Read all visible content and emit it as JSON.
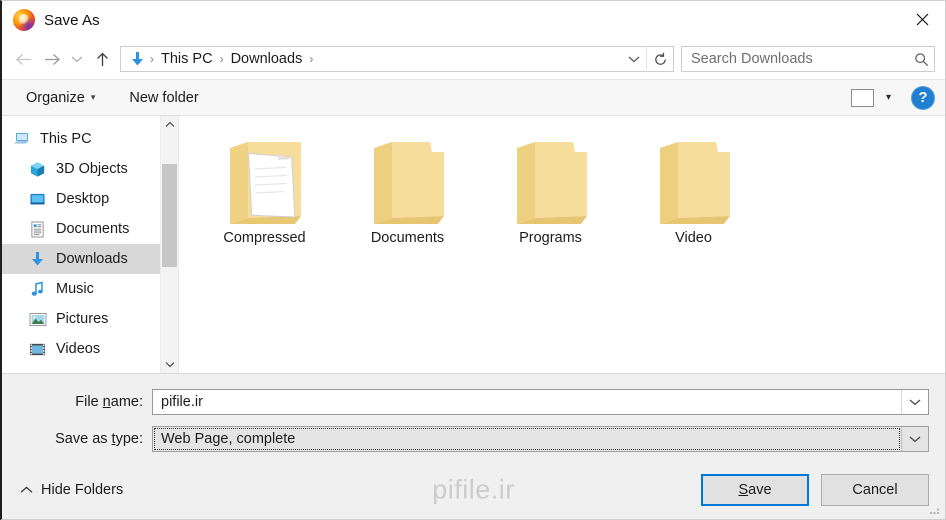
{
  "window": {
    "title": "Save As",
    "app_icon": "firefox-icon",
    "close_label": "✕"
  },
  "nav": {
    "back": "←",
    "forward": "→",
    "recent": "⌄",
    "up": "↑",
    "refresh": "↻"
  },
  "breadcrumb": {
    "icon": "downloads-arrow-icon",
    "items": [
      "This PC",
      "Downloads"
    ],
    "separator": "›",
    "dropdown": "⌄"
  },
  "search": {
    "placeholder": "Search Downloads",
    "value": "",
    "icon": "search-icon"
  },
  "toolbar": {
    "organize_label": "Organize",
    "organize_caret": "▾",
    "new_folder_label": "New folder",
    "view_icon": "thumbnail-view-icon",
    "view_caret": "▾",
    "help_label": "?"
  },
  "sidebar": {
    "items": [
      {
        "label": "This PC",
        "icon": "this-pc-icon",
        "selected": false,
        "root": true
      },
      {
        "label": "3D Objects",
        "icon": "3d-objects-icon",
        "selected": false,
        "root": false
      },
      {
        "label": "Desktop",
        "icon": "desktop-icon",
        "selected": false,
        "root": false
      },
      {
        "label": "Documents",
        "icon": "documents-icon",
        "selected": false,
        "root": false
      },
      {
        "label": "Downloads",
        "icon": "downloads-icon",
        "selected": true,
        "root": false
      },
      {
        "label": "Music",
        "icon": "music-icon",
        "selected": false,
        "root": false
      },
      {
        "label": "Pictures",
        "icon": "pictures-icon",
        "selected": false,
        "root": false
      },
      {
        "label": "Videos",
        "icon": "videos-icon",
        "selected": false,
        "root": false
      }
    ],
    "scroll_up": "⌃",
    "scroll_down": "⌄"
  },
  "files": [
    {
      "label": "Compressed",
      "icon": "folder-with-document-icon"
    },
    {
      "label": "Documents",
      "icon": "folder-icon"
    },
    {
      "label": "Programs",
      "icon": "folder-icon"
    },
    {
      "label": "Video",
      "icon": "folder-icon"
    }
  ],
  "form": {
    "file_name_label": "File name:",
    "file_name_accel": "n",
    "file_name_value": "pifile.ir",
    "save_type_label": "Save as type:",
    "save_type_accel": "t",
    "save_type_value": "Web Page, complete",
    "dropdown_caret": "⌄"
  },
  "footer": {
    "hide_folders_label": "Hide Folders",
    "hide_folders_caret": "⌃",
    "watermark": "pifile.ir",
    "save_label": "Save",
    "save_accel": "S",
    "cancel_label": "Cancel"
  },
  "colors": {
    "accent": "#0078d7",
    "selection": "#d8d8d8",
    "folder": "#f5d77e",
    "panel": "#f0f0f0",
    "help_blue": "#1f7fd0"
  }
}
